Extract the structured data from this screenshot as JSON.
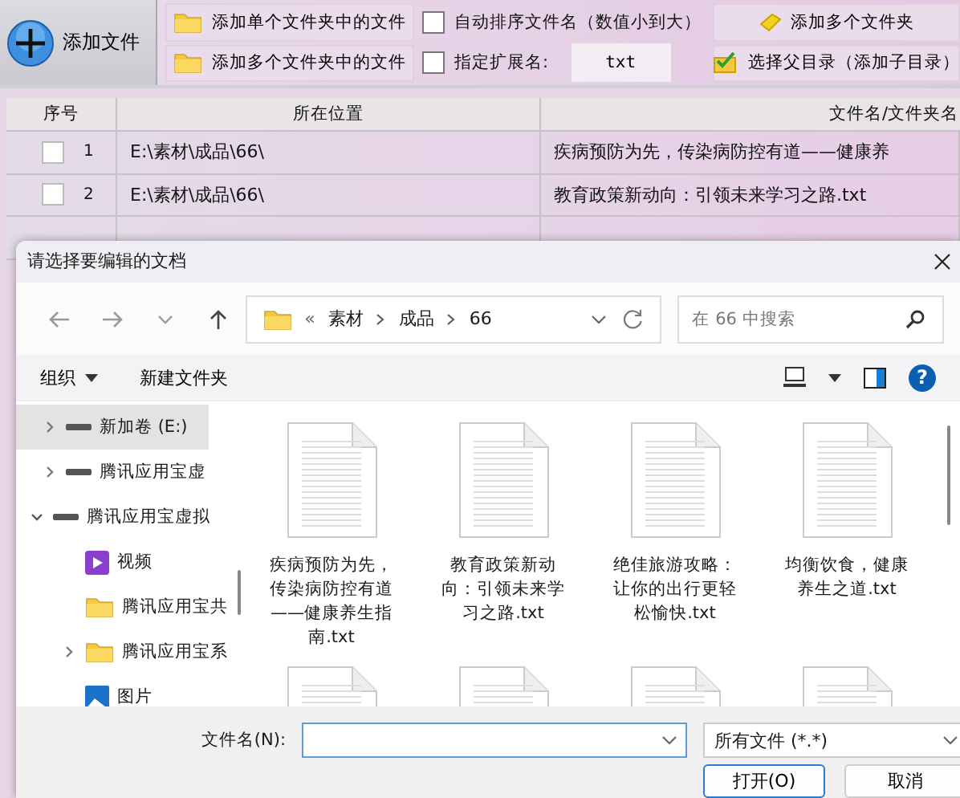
{
  "toolbar": {
    "add_file": "添加文件",
    "left_buttons": [
      {
        "label": "添加单个文件夹中的文件"
      },
      {
        "label": "添加多个文件夹中的文件"
      }
    ],
    "options": [
      {
        "kind": "checkbox",
        "label": "自动排序文件名（数值小到大）",
        "checked": false
      },
      {
        "kind": "extension",
        "label": "指定扩展名:",
        "checked": false,
        "value": "txt"
      }
    ],
    "right_buttons": [
      {
        "kind": "diamond",
        "label": "添加多个文件夹"
      },
      {
        "kind": "check-folder",
        "label": "选择父目录（添加子目录）"
      }
    ]
  },
  "table": {
    "columns": [
      "序号",
      "所在位置",
      "文件名/文件夹名"
    ],
    "rows": [
      {
        "checked": false,
        "index": "1",
        "location": "E:\\素材\\成品\\66\\",
        "name": "疾病预防为先，传染病防控有道——健康养"
      },
      {
        "checked": false,
        "index": "2",
        "location": "E:\\素材\\成品\\66\\",
        "name": "教育政策新动向：引领未来学习之路.txt"
      }
    ]
  },
  "dialog": {
    "title": "请选择要编辑的文档",
    "breadcrumb": {
      "overflow": "«",
      "parts": [
        "素材",
        "成品",
        "66"
      ]
    },
    "search": {
      "placeholder": "在 66 中搜索"
    },
    "commands": {
      "organize": "组织",
      "new_folder": "新建文件夹",
      "help": "?"
    },
    "nav_pane": [
      {
        "kind": "drive",
        "label": "新加卷 (E:)",
        "selected": true,
        "expanded": false
      },
      {
        "kind": "drive",
        "label": "腾讯应用宝虚",
        "selected": false,
        "expanded": false
      },
      {
        "kind": "drive",
        "label": "腾讯应用宝虚拟",
        "selected": false,
        "expanded": true,
        "children": [
          {
            "kind": "video",
            "label": "视频",
            "selected": false
          },
          {
            "kind": "folder",
            "label": "腾讯应用宝共",
            "selected": false
          },
          {
            "kind": "folder",
            "label": "腾讯应用宝系",
            "selected": false,
            "expanded": false
          },
          {
            "kind": "pictures",
            "label": "图片",
            "selected": false
          }
        ]
      }
    ],
    "files": [
      {
        "kind": "labeled",
        "name": "疾病预防为先，传染病防控有道——健康养生指南.txt"
      },
      {
        "kind": "labeled",
        "name": "教育政策新动向：引领未来学习之路.txt"
      },
      {
        "kind": "labeled",
        "name": "绝佳旅游攻略：让你的出行更轻松愉快.txt"
      },
      {
        "kind": "labeled",
        "name": "均衡饮食，健康养生之道.txt"
      },
      {
        "kind": "partial"
      },
      {
        "kind": "partial"
      },
      {
        "kind": "partial"
      },
      {
        "kind": "partial"
      }
    ],
    "filename": {
      "label": "文件名(N):"
    },
    "filetype": "所有文件 (*.*)",
    "buttons": [
      {
        "label": "打开(O)",
        "default": true
      },
      {
        "label": "取消",
        "default": false
      }
    ]
  }
}
